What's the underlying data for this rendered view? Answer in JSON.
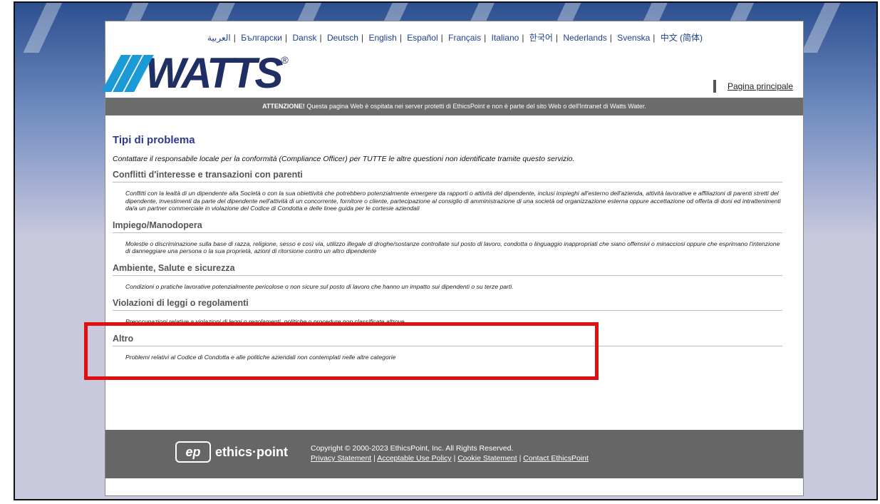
{
  "languages": [
    "العربية",
    "Български",
    "Dansk",
    "Deutsch",
    "English",
    "Español",
    "Français",
    "Italiano",
    "한국어",
    "Nederlands",
    "Svenska",
    "中文 (简体)"
  ],
  "logo": {
    "text": "WATTS",
    "reg": "®"
  },
  "home_link": "Pagina principale",
  "notice": {
    "bold": "ATTENZIONE!",
    "text": " Questa pagina Web è ospitata nei server protetti di EthicsPoint e non è parte del sito Web o dell'Intranet di Watts Water."
  },
  "main": {
    "title": "Tipi di problema",
    "intro": "Contattare il responsabile locale per la conformità (Compliance Officer) per TUTTE le altre questioni non identificate tramite questo servizio.",
    "categories": [
      {
        "title": "Conflitti d'interesse e transazioni con parenti",
        "desc": "Conflitti con la lealtà di un dipendente alla Società o con la sua obiettività che potrebbero potenzialmente emergere da rapporti o attività del dipendente, inclusi impieghi all'esterno dell'azienda, attività lavorative e affiliazioni di parenti stretti del dipendente, investimenti da parte del dipendente nell'attività di un concorrente, fornitore o cliente, partecipazione al consiglio di amministrazione di una società od organizzazione esterna oppure accettazione od offerta di doni ed intrattenimenti da/a un partner commerciale in violazione del Codice di Condotta e delle linee guida per le cortesie aziendali"
      },
      {
        "title": "Impiego/Manodopera",
        "desc": "Molestie o discriminazione sulla base di razza, religione, sesso e così via, utilizzo illegale di droghe/sostanze controllate sul posto di lavoro, condotta o linguaggio inappropriati che siano offensivi o minacciosi oppure che esprimano l'intenzione di danneggiare una persona o la sua proprietà, azioni di ritorsione contro un altro dipendente"
      },
      {
        "title": "Ambiente, Salute e sicurezza",
        "desc": "Condizioni o pratiche lavorative potenzialmente pericolose o non sicure sul posto di lavoro che hanno un impatto sui dipendenti o su terze parti."
      },
      {
        "title": "Violazioni di leggi o regolamenti",
        "desc": "Preoccupazioni relative a violazioni di leggi o regolamenti, politiche o procedure non classificate altrove."
      },
      {
        "title": "Altro",
        "desc": "Problemi relativi al Codice di Condotta e alle politiche aziendali non contemplati nelle altre categorie"
      }
    ]
  },
  "footer": {
    "logo_mark": "ep",
    "logo_text": "ethics·point",
    "copyright": "Copyright © 2000-2023 EthicsPoint, Inc. All Rights Reserved.",
    "links": [
      "Privacy Statement",
      "Acceptable Use Policy",
      "Cookie Statement",
      "Contact EthicsPoint"
    ]
  },
  "colors": {
    "highlight": "#e01010",
    "notice_bg": "#6b6b6b",
    "title": "#2b3a8f"
  }
}
